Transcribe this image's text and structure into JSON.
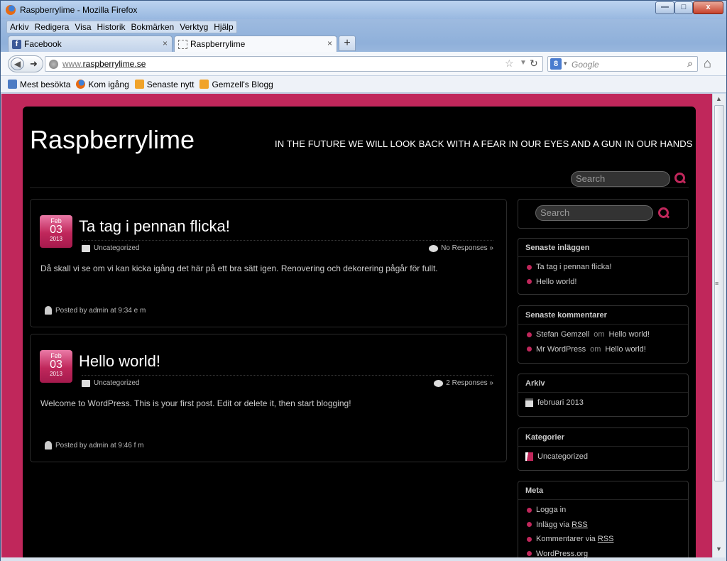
{
  "window": {
    "title": "Raspberrylime - Mozilla Firefox",
    "min": "—",
    "max": "□",
    "close": "x"
  },
  "menu": [
    "Arkiv",
    "Redigera",
    "Visa",
    "Historik",
    "Bokmärken",
    "Verktyg",
    "Hjälp"
  ],
  "tabs": [
    {
      "label": "Facebook",
      "icon": "facebook-icon"
    },
    {
      "label": "Raspberrylime",
      "icon": "blank-page-icon"
    }
  ],
  "tab_close": "×",
  "new_tab": "+",
  "nav": {
    "url_prefix": "www.",
    "url_domain": "raspberrylime.se",
    "search_placeholder": "Google",
    "search_engine": "8"
  },
  "bookmarks": [
    {
      "label": "Mest besökta",
      "icon": "star"
    },
    {
      "label": "Kom igång",
      "icon": "ffx"
    },
    {
      "label": "Senaste nytt",
      "icon": "rss"
    },
    {
      "label": "Gemzell's Blogg",
      "icon": "rss"
    }
  ],
  "site": {
    "title": "Raspberrylime",
    "tagline": "IN THE FUTURE WE WILL LOOK BACK WITH A FEAR IN OUR EYES AND A GUN IN OUR HANDS",
    "search_placeholder": "Search"
  },
  "posts": [
    {
      "month": "Feb",
      "day": "03",
      "year": "2013",
      "title": "Ta tag i pennan flicka!",
      "category": "Uncategorized",
      "responses": "No Responses »",
      "body": "Då skall vi se om vi kan kicka igång det här på ett bra sätt igen. Renovering och dekorering pågår för fullt.",
      "footer": "Posted by admin at 9:34 e m"
    },
    {
      "month": "Feb",
      "day": "03",
      "year": "2013",
      "title": "Hello world!",
      "category": "Uncategorized",
      "responses": "2 Responses »",
      "body": "Welcome to WordPress. This is your first post. Edit or delete it, then start blogging!",
      "footer": "Posted by admin at 9:46 f m"
    }
  ],
  "sidebar": {
    "search_placeholder": "Search",
    "recent_title": "Senaste inläggen",
    "recent": [
      "Ta tag i pennan flicka!",
      "Hello world!"
    ],
    "comments_title": "Senaste kommentarer",
    "comments": [
      {
        "author": "Stefan Gemzell",
        "om": "om",
        "post": "Hello world!"
      },
      {
        "author": "Mr WordPress",
        "om": "om",
        "post": "Hello world!"
      }
    ],
    "archive_title": "Arkiv",
    "archive": "februari 2013",
    "categories_title": "Kategorier",
    "category": "Uncategorized",
    "meta_title": "Meta",
    "meta": {
      "login": "Logga in",
      "entries_prefix": "Inlägg via ",
      "entries_rss": "RSS",
      "comments_prefix": "Kommentarer via ",
      "comments_rss": "RSS",
      "wordpress": "WordPress.org"
    }
  },
  "colors": {
    "accent": "#c0275b",
    "page_bg": "#000000"
  }
}
